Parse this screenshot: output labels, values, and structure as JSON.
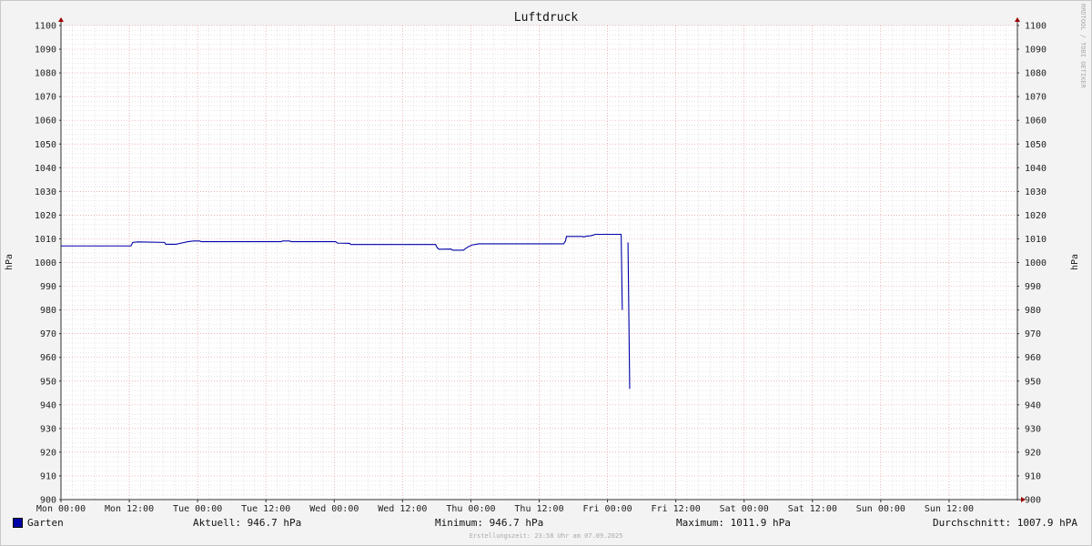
{
  "chart_data": {
    "type": "line",
    "title": "Luftdruck",
    "ylabel": "hPa",
    "ylim": [
      900,
      1100
    ],
    "y_ticks": [
      900,
      910,
      920,
      930,
      940,
      950,
      960,
      970,
      980,
      990,
      1000,
      1010,
      1020,
      1030,
      1040,
      1050,
      1060,
      1070,
      1080,
      1090,
      1100
    ],
    "x_range_hours": [
      0,
      168
    ],
    "x_ticks": [
      {
        "label": "Mon 00:00",
        "h": 0
      },
      {
        "label": "Mon 12:00",
        "h": 12
      },
      {
        "label": "Tue 00:00",
        "h": 24
      },
      {
        "label": "Tue 12:00",
        "h": 36
      },
      {
        "label": "Wed 00:00",
        "h": 48
      },
      {
        "label": "Wed 12:00",
        "h": 60
      },
      {
        "label": "Thu 00:00",
        "h": 72
      },
      {
        "label": "Thu 12:00",
        "h": 84
      },
      {
        "label": "Fri 00:00",
        "h": 96
      },
      {
        "label": "Fri 12:00",
        "h": 108
      },
      {
        "label": "Sat 00:00",
        "h": 120
      },
      {
        "label": "Sat 12:00",
        "h": 132
      },
      {
        "label": "Sun 00:00",
        "h": 144
      },
      {
        "label": "Sun 12:00",
        "h": 156
      }
    ],
    "grid": true,
    "legend_position": "bottom",
    "series": [
      {
        "name": "Garten",
        "color": "#0000a8",
        "points": [
          [
            0,
            1007.0
          ],
          [
            12.3,
            1007.0
          ],
          [
            12.6,
            1008.5
          ],
          [
            13.5,
            1008.7
          ],
          [
            18.2,
            1008.5
          ],
          [
            18.4,
            1007.7
          ],
          [
            20.2,
            1007.7
          ],
          [
            21.3,
            1008.3
          ],
          [
            22.3,
            1008.8
          ],
          [
            23.3,
            1009.1
          ],
          [
            24.4,
            1009.1
          ],
          [
            24.6,
            1008.8
          ],
          [
            38.7,
            1008.8
          ],
          [
            38.9,
            1009.1
          ],
          [
            40.2,
            1009.1
          ],
          [
            40.4,
            1008.8
          ],
          [
            48.2,
            1008.8
          ],
          [
            48.6,
            1008.2
          ],
          [
            50.7,
            1008.1
          ],
          [
            50.9,
            1007.6
          ],
          [
            65.8,
            1007.6
          ],
          [
            66.1,
            1006.2
          ],
          [
            66.4,
            1005.6
          ],
          [
            68.5,
            1005.7
          ],
          [
            68.8,
            1005.2
          ],
          [
            70.7,
            1005.2
          ],
          [
            71.0,
            1005.8
          ],
          [
            71.5,
            1006.6
          ],
          [
            72.2,
            1007.4
          ],
          [
            73.4,
            1007.9
          ],
          [
            88.3,
            1007.9
          ],
          [
            88.6,
            1009.0
          ],
          [
            88.8,
            1011.0
          ],
          [
            91.6,
            1011.0
          ],
          [
            91.8,
            1010.8
          ],
          [
            92.3,
            1011.1
          ],
          [
            93.1,
            1011.3
          ],
          [
            93.9,
            1011.9
          ],
          [
            98.4,
            1011.9
          ],
          [
            98.6,
            980.0
          ],
          null,
          [
            99.6,
            1008.5
          ],
          [
            99.9,
            946.7
          ]
        ]
      }
    ]
  },
  "legend": {
    "series_name": "Garten",
    "aktuell": "Aktuell: 946.7 hPa",
    "minimum": "Minimum: 946.7 hPa",
    "maximum": "Maximum: 1011.9 hPa",
    "durchschnitt": "Durchschnitt: 1007.9 hPA"
  },
  "watermark": "RRDTOOL / TOBI OETIKER",
  "footer": "Erstellungszeit: 23:58 Uhr am 07.09.2025"
}
